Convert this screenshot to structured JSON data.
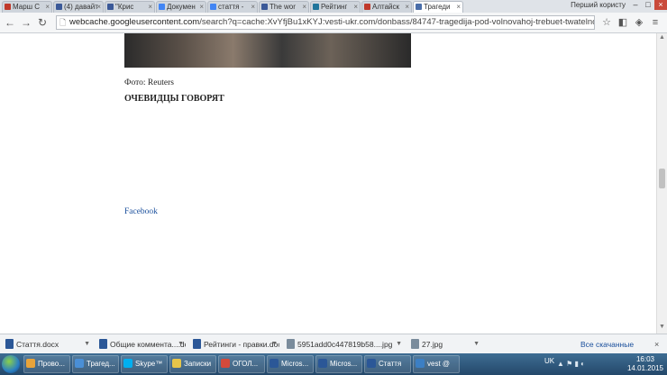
{
  "browser": {
    "tabs": [
      {
        "label": "Марш С",
        "favicon_color": "#c0392b"
      },
      {
        "label": "(4) давайте",
        "favicon_color": "#3b5998"
      },
      {
        "label": "\"Крис",
        "favicon_color": "#3b5998"
      },
      {
        "label": "Докумен",
        "favicon_color": "#4285f4"
      },
      {
        "label": "стаття -",
        "favicon_color": "#4285f4"
      },
      {
        "label": "The wor",
        "favicon_color": "#3b5998"
      },
      {
        "label": "Рейтинг",
        "favicon_color": "#21759b"
      },
      {
        "label": "Алтайск",
        "favicon_color": "#c0392b"
      },
      {
        "label": "Трагеди",
        "favicon_color": "#4a6ea9",
        "active": true
      }
    ],
    "user_label": "Перший користу",
    "address_host": "webcache.googleusercontent.com",
    "address_rest": "/search?q=cache:XvYfjBu1xKYJ:vesti-ukr.com/donbass/84747-tragedija-pod-volnovahoj-trebuet-twatelnogo-i-nepredv"
  },
  "article": {
    "photo_caption": "Фото: Reuters",
    "section_heading": "ОЧЕВИДЦЫ ГОВОРЯТ",
    "paragraph_1": "",
    "paragraph_2": "",
    "paragraph_3_link": "Facebook",
    "paragraph_3": "",
    "paragraph_4": ""
  },
  "downloads": {
    "items": [
      {
        "label": "Стаття.docx",
        "icon_color": "#2b5797"
      },
      {
        "label": "Общие коммента....docx",
        "icon_color": "#2b5797"
      },
      {
        "label": "Рейтинги - правки.docx",
        "icon_color": "#2b5797"
      },
      {
        "label": "5951add0c447819b58....jpg",
        "icon_color": "#7a8c9c"
      },
      {
        "label": "27.jpg",
        "icon_color": "#7a8c9c"
      }
    ],
    "show_all": "Все скачанные файлы..."
  },
  "taskbar": {
    "items": [
      {
        "label": "Прово...",
        "icon_color": "#e8a33a"
      },
      {
        "label": "Трагед...",
        "icon_color": "#4a8fd6"
      },
      {
        "label": "Skype™",
        "icon_color": "#00aff0"
      },
      {
        "label": "Записки",
        "icon_color": "#e6c54a"
      },
      {
        "label": "ОГОЛ...",
        "icon_color": "#d44a3b"
      },
      {
        "label": "Micros...",
        "icon_color": "#2b5797"
      },
      {
        "label": "Micros...",
        "icon_color": "#2b5797"
      },
      {
        "label": "Стаття",
        "icon_color": "#2b5797"
      },
      {
        "label": "vest @",
        "icon_color": "#3c7fc4"
      }
    ],
    "language": "UK",
    "time": "16:03",
    "date": "14.01.2015"
  }
}
